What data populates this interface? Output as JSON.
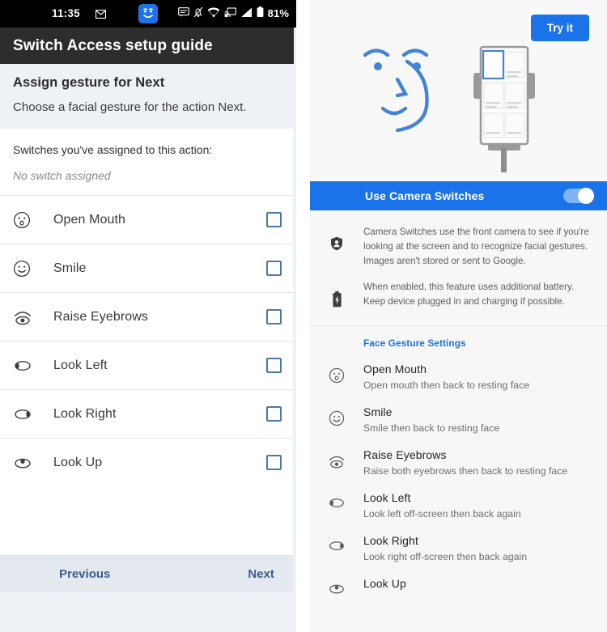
{
  "left": {
    "statusbar": {
      "time": "11:35",
      "battery_pct": "81%",
      "icons": [
        "mail-icon",
        "face-switch-icon",
        "message-icon",
        "silent-icon",
        "wifi-icon",
        "cast-icon",
        "signal-icon",
        "battery-icon"
      ]
    },
    "toolbar": {
      "title": "Switch Access setup guide"
    },
    "assign": {
      "title": "Assign gesture for Next",
      "subtitle": "Choose a facial gesture for the action Next."
    },
    "assigned": {
      "label": "Switches you've assigned to this action:",
      "value": "No switch assigned"
    },
    "gestures": [
      {
        "icon": "open-mouth-face-icon",
        "label": "Open Mouth",
        "checked": false
      },
      {
        "icon": "smile-face-icon",
        "label": "Smile",
        "checked": false
      },
      {
        "icon": "raise-eyebrows-eye-icon",
        "label": "Raise Eyebrows",
        "checked": false
      },
      {
        "icon": "look-left-eye-icon",
        "label": "Look Left",
        "checked": false
      },
      {
        "icon": "look-right-eye-icon",
        "label": "Look Right",
        "checked": false
      },
      {
        "icon": "look-up-eye-icon",
        "label": "Look Up",
        "checked": false
      }
    ],
    "bottom": {
      "previous": "Previous",
      "next": "Next"
    }
  },
  "right": {
    "hero": {
      "try_button": "Try it",
      "illustration": [
        "face-line-art",
        "phone-on-stand-illustration"
      ]
    },
    "camera_switches": {
      "label": "Use Camera Switches",
      "toggle_state": "on"
    },
    "info": [
      {
        "icon": "shield-person-icon",
        "text": "Camera Switches use the front camera to see if you're looking at the screen and to recognize facial gestures. Images aren't stored or sent to Google."
      },
      {
        "icon": "battery-charging-icon",
        "text": "When enabled, this feature uses additional battery. Keep device plugged in and charging if possible."
      }
    ],
    "face_gesture_settings": {
      "heading": "Face Gesture Settings",
      "items": [
        {
          "icon": "open-mouth-face-icon",
          "title": "Open Mouth",
          "subtitle": "Open mouth then back to resting face"
        },
        {
          "icon": "smile-face-icon",
          "title": "Smile",
          "subtitle": "Smile then back to resting face"
        },
        {
          "icon": "raise-eyebrows-eye-icon",
          "title": "Raise Eyebrows",
          "subtitle": "Raise both eyebrows then back to resting face"
        },
        {
          "icon": "look-left-eye-icon",
          "title": "Look Left",
          "subtitle": "Look left off-screen then back again"
        },
        {
          "icon": "look-right-eye-icon",
          "title": "Look Right",
          "subtitle": "Look right off-screen then back again"
        },
        {
          "icon": "look-up-eye-icon",
          "title": "Look Up",
          "subtitle": ""
        }
      ]
    }
  },
  "colors": {
    "accent_blue": "#1a73e8",
    "toolbar_dark": "#2d2d2d",
    "statusbar_black": "#000000",
    "panel_grey": "#eef1f6",
    "right_bg": "#f7f7f7",
    "checkbox_border": "#4a7aa5",
    "link_blue": "#3a5d8f"
  }
}
